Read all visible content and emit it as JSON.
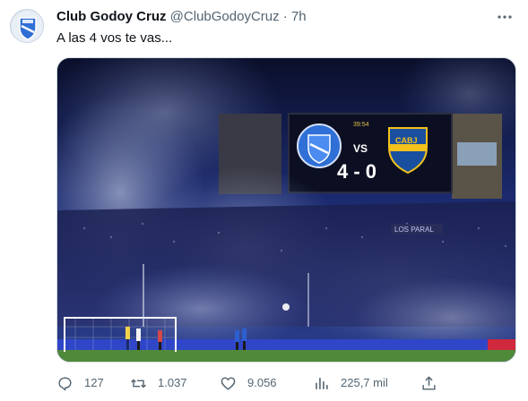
{
  "tweet": {
    "author_name": "Club Godoy Cruz",
    "handle": "@ClubGodoyCruz",
    "separator": "·",
    "time": "7h",
    "text": "A las 4 vos te vas...",
    "more_icon": "more-horizontal-icon"
  },
  "media": {
    "scoreboard": {
      "clock": "39:54",
      "vs": "VS",
      "score": "4 - 0",
      "away_badge": "CABJ"
    },
    "banner": "LOS PARAL"
  },
  "actions": {
    "replies": "127",
    "retweets": "1.037",
    "likes": "9.056",
    "views": "225,7 mil"
  },
  "colors": {
    "text_primary": "#0f1419",
    "text_secondary": "#536471",
    "border": "#cfd9de",
    "godoy_blue": "#2f6fd6",
    "boca_blue": "#1a4fa0",
    "boca_gold": "#f2c21b"
  }
}
